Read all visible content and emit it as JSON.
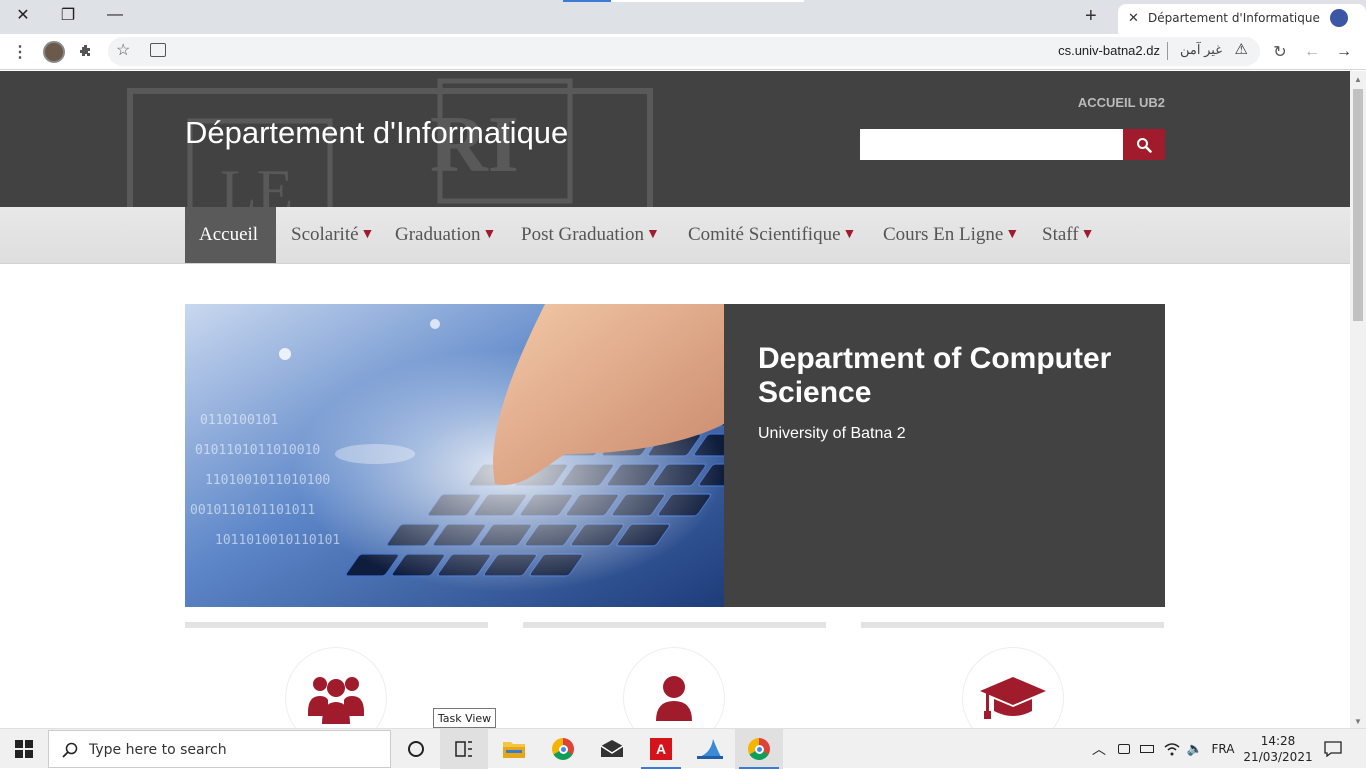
{
  "browser": {
    "tab_title": "Département d'Informatique",
    "url": "cs.univ-batna2.dz",
    "security_text": "غير آمن"
  },
  "page": {
    "top_link": "ACCUEIL UB2",
    "site_title": "Département d'Informatique",
    "nav": [
      {
        "label": "Accueil",
        "dropdown": false,
        "active": true
      },
      {
        "label": "Scolarité",
        "dropdown": true
      },
      {
        "label": "Graduation",
        "dropdown": true
      },
      {
        "label": "Post Graduation",
        "dropdown": true
      },
      {
        "label": "Comité Scientifique",
        "dropdown": true
      },
      {
        "label": "Cours En Ligne",
        "dropdown": true
      },
      {
        "label": "Staff",
        "dropdown": true
      }
    ],
    "hero": {
      "title": "Department of Computer Science",
      "subtitle": "University of Batna 2"
    },
    "features": [
      {
        "icon": "group-icon"
      },
      {
        "icon": "person-icon"
      },
      {
        "icon": "graduation-cap-icon"
      }
    ],
    "accent_color": "#a01b2b",
    "header_color": "#424242"
  },
  "taskbar": {
    "search_placeholder": "Type here to search",
    "tooltip": "Task View",
    "language": "FRA",
    "time": "14:28",
    "date": "21/03/2021"
  }
}
